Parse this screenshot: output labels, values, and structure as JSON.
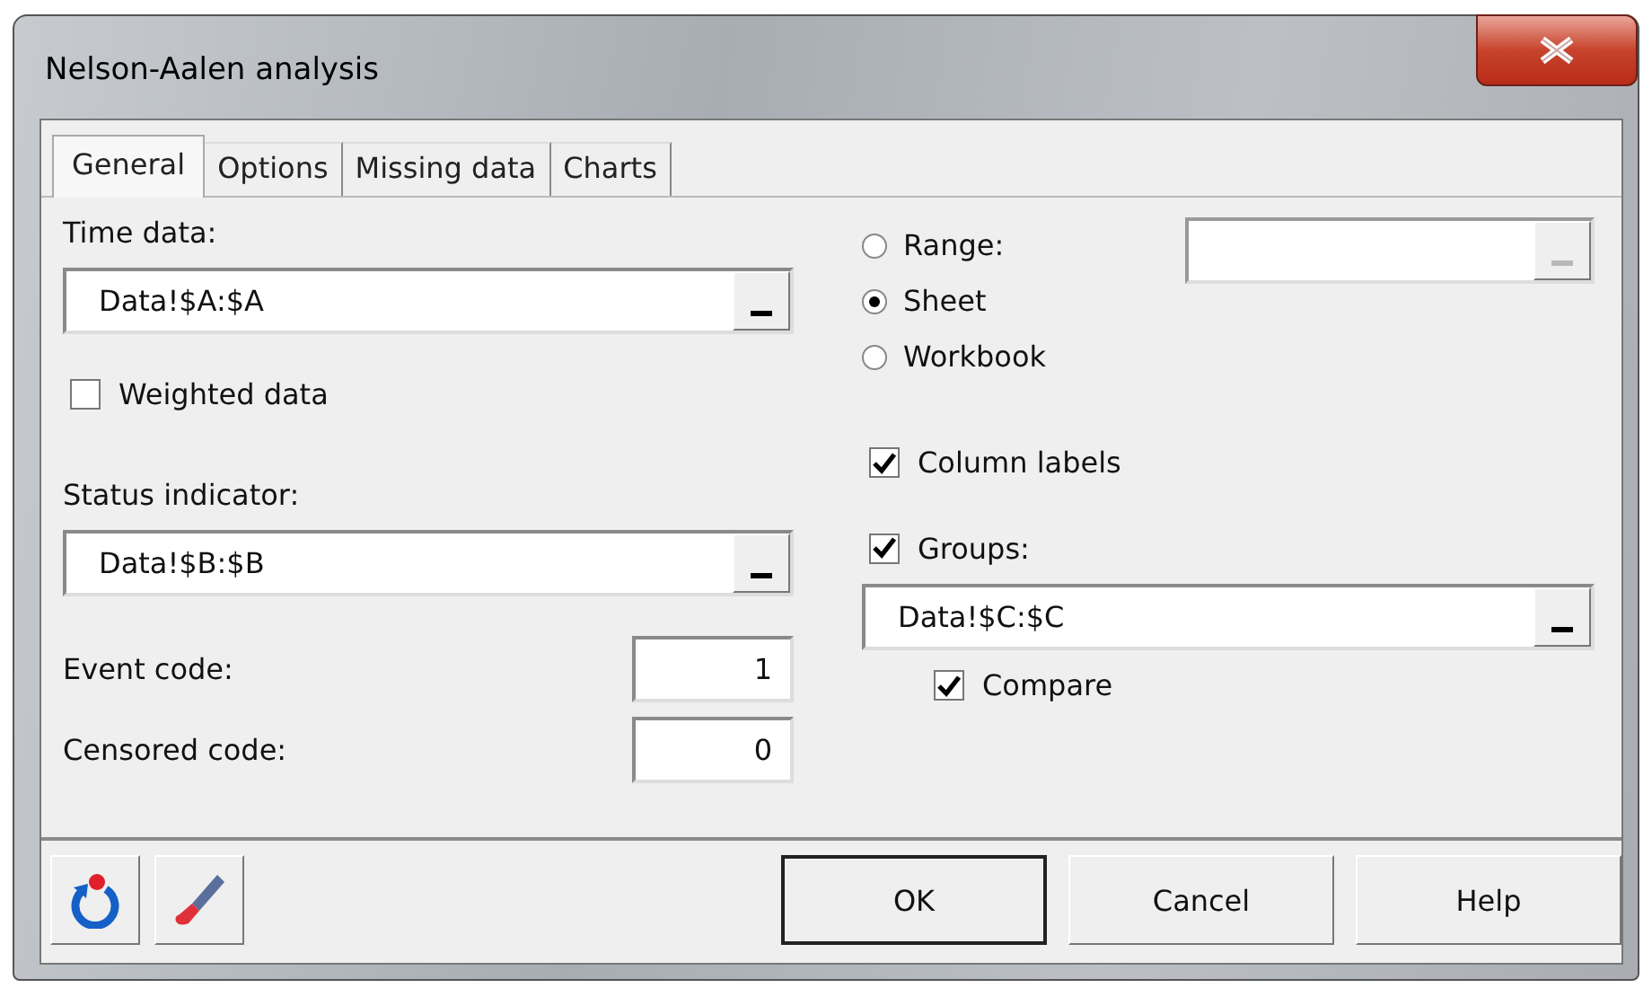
{
  "window": {
    "title": "Nelson-Aalen analysis"
  },
  "tabs": [
    {
      "label": "General",
      "selected": true
    },
    {
      "label": "Options",
      "selected": false
    },
    {
      "label": "Missing data",
      "selected": false
    },
    {
      "label": "Charts",
      "selected": false
    }
  ],
  "time_data": {
    "label": "Time data:",
    "value": "Data!$A:$A"
  },
  "weighted_data": {
    "label": "Weighted data",
    "checked": false
  },
  "status_indicator": {
    "label": "Status indicator:",
    "value": "Data!$B:$B"
  },
  "event_code": {
    "label": "Event code:",
    "value": "1"
  },
  "censored_code": {
    "label": "Censored code:",
    "value": "0"
  },
  "output_options": [
    {
      "label": "Range:",
      "selected": false
    },
    {
      "label": "Sheet",
      "selected": true
    },
    {
      "label": "Workbook",
      "selected": false
    }
  ],
  "range_field": {
    "disabled": true
  },
  "column_labels": {
    "label": "Column labels",
    "checked": true
  },
  "groups": {
    "label": "Groups:",
    "checked": true,
    "value": "Data!$C:$C"
  },
  "compare": {
    "label": "Compare",
    "checked": true
  },
  "buttons": [
    {
      "label": "OK",
      "default": true
    },
    {
      "label": "Cancel",
      "default": false
    },
    {
      "label": "Help",
      "default": false
    }
  ]
}
